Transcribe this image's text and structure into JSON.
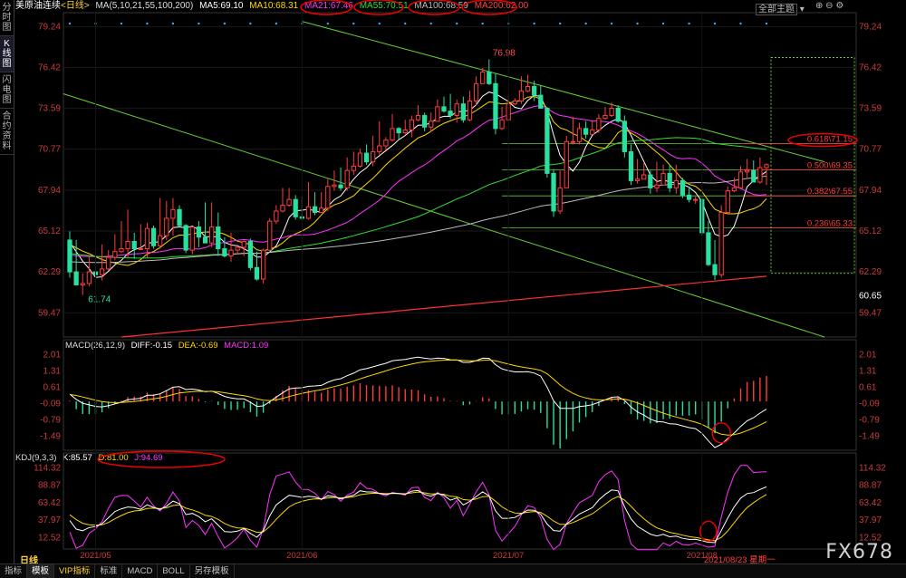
{
  "sidebar": {
    "tabs": [
      "分时图",
      "K线图",
      "闪电图",
      "合约资料"
    ]
  },
  "header": {
    "symbol": "美原油连续",
    "period": "<日线>",
    "ma_params": "MA(5,10,21,55,100,200)",
    "ma_values": [
      {
        "label": "MA5:69.10",
        "color": "#ffffff"
      },
      {
        "label": "MA10:68.31",
        "color": "#ffd700"
      },
      {
        "label": "MA21:67.46",
        "color": "#ff33ff"
      },
      {
        "label": "MA55:70.51",
        "color": "#33dd33"
      },
      {
        "label": "MA100:68.59",
        "color": "#bbbbbb"
      },
      {
        "label": "MA200:62.00",
        "color": "#ff4444"
      }
    ],
    "theme_button": "全部主题",
    "colors": {
      "up": "#ff3c3c",
      "down": "#29e0a0"
    }
  },
  "main_chart": {
    "y_ticks": [
      "79.24",
      "76.42",
      "73.59",
      "70.77",
      "67.94",
      "65.12",
      "62.29",
      "59.47"
    ],
    "extra_price": "60.65",
    "high_label": "76.98",
    "low_label": "61.74",
    "fib_levels": [
      {
        "label": "0.618\\71.15",
        "price": 71.15
      },
      {
        "label": "0.500\\69.35",
        "price": 69.35
      },
      {
        "label": "0.382\\67.55",
        "price": 67.55
      },
      {
        "label": "0.236\\65.33",
        "price": 65.33
      }
    ]
  },
  "macd": {
    "title": "MACD(26,12,9)",
    "diff": "DIFF:-0.15",
    "dea": "DEA:-0.69",
    "macd": "MACD:1.09",
    "y_ticks": [
      "2.01",
      "1.31",
      "0.61",
      "-0.09",
      "-0.79",
      "-1.49"
    ]
  },
  "kdj": {
    "title": "KDJ(9,3,3)",
    "k": "K:85.57",
    "d": "D:81.00",
    "j": "J:94.69",
    "y_ticks": [
      "114.32",
      "88.87",
      "63.42",
      "37.97",
      "12.52"
    ]
  },
  "x_axis": {
    "labels": [
      "2021/05",
      "2021/06",
      "2021/07",
      "2021/08"
    ],
    "current_date": "2021/08/23 星期一"
  },
  "bottom_tabs": {
    "period_label": "日线",
    "tabs": [
      "指标",
      "模板",
      "VIP指标",
      "标准",
      "MACD",
      "BOLL",
      "另存模板"
    ],
    "active": "模板"
  },
  "watermark": "FX678",
  "chart_data": {
    "type": "candlestick",
    "open": [
      64.5,
      62.3,
      61.4,
      61.5,
      62.3,
      62.1,
      62.5,
      63.3,
      63.7,
      63.9,
      64.4,
      63.9,
      63.9,
      65.3,
      64.1,
      64.8,
      66.0,
      66.6,
      65.5,
      63.8,
      65.4,
      64.7,
      64.3,
      65.4,
      63.9,
      63.4,
      63.8,
      64.0,
      64.4,
      62.6,
      61.8,
      63.8,
      65.8,
      66.5,
      66.9,
      67.3,
      66.1,
      66.0,
      66.8,
      66.4,
      66.7,
      68.2,
      68.3,
      68.1,
      69.3,
      69.6,
      70.5,
      69.9,
      70.6,
      71.0,
      71.4,
      72.2,
      71.9,
      72.1,
      72.8,
      73.1,
      72.3,
      72.7,
      73.7,
      73.4,
      73.1,
      73.9,
      72.8,
      74.1,
      75.3,
      76.1,
      75.3,
      72.2,
      72.8,
      73.9,
      74.1,
      74.8,
      75.1,
      74.5,
      73.6,
      69.1,
      66.5,
      68.1,
      71.3,
      71.3,
      72.2,
      71.8,
      72.1,
      72.9,
      73.1,
      73.6,
      72.7,
      70.6,
      68.6,
      68.7,
      69.0,
      68.1,
      68.3,
      69.1,
      68.1,
      68.6,
      67.6,
      67.3,
      67.3,
      65.0,
      62.8,
      62.1,
      66.4,
      67.9,
      68.1,
      69.2,
      69.3,
      68.5,
      69.5
    ],
    "high": [
      65.1,
      64.5,
      62.2,
      63.4,
      63.8,
      64.2,
      63.8,
      64.9,
      65.8,
      66.6,
      65.0,
      65.6,
      65.7,
      65.5,
      67.4,
      67.2,
      67.4,
      66.9,
      65.6,
      65.2,
      65.8,
      67.1,
      67.1,
      66.4,
      64.7,
      65.0,
      64.2,
      64.5,
      64.6,
      63.7,
      63.9,
      66.0,
      66.9,
      68.1,
      68.1,
      67.6,
      67.5,
      68.5,
      67.8,
      67.8,
      68.7,
      69.3,
      69.5,
      70.2,
      70.6,
      70.8,
      71.1,
      71.7,
      72.7,
      71.6,
      73.2,
      72.3,
      72.8,
      73.1,
      73.8,
      73.3,
      73.3,
      74.2,
      74.4,
      74.6,
      74.2,
      74.4,
      74.8,
      75.8,
      76.4,
      76.98,
      76.0,
      73.7,
      74.5,
      74.3,
      75.8,
      75.9,
      75.5,
      75.2,
      73.7,
      69.4,
      69.3,
      71.7,
      73.0,
      72.6,
      72.7,
      72.7,
      73.2,
      73.7,
      74.0,
      73.8,
      73.1,
      71.1,
      70.1,
      69.8,
      69.3,
      69.9,
      69.7,
      69.7,
      69.7,
      68.8,
      68.2,
      67.5,
      67.5,
      65.8,
      64.5,
      66.9,
      68.2,
      68.8,
      69.6,
      70.1,
      70.0,
      70.2,
      69.8
    ],
    "low": [
      61.9,
      61.4,
      60.7,
      61.3,
      61.9,
      61.7,
      62.4,
      63.1,
      63.6,
      63.3,
      63.2,
      63.8,
      63.3,
      63.9,
      63.9,
      64.5,
      64.8,
      65.4,
      63.6,
      63.5,
      64.0,
      64.3,
      64.0,
      63.4,
      63.3,
      63.0,
      63.5,
      63.4,
      62.4,
      61.7,
      61.5,
      63.8,
      65.6,
      66.4,
      66.8,
      65.9,
      65.9,
      65.9,
      66.2,
      66.4,
      66.5,
      67.9,
      67.9,
      67.9,
      69.0,
      69.5,
      69.7,
      69.6,
      70.4,
      70.7,
      71.3,
      71.4,
      71.8,
      71.6,
      72.7,
      72.0,
      72.0,
      72.7,
      73.3,
      72.9,
      72.6,
      72.6,
      72.7,
      73.8,
      75.3,
      75.2,
      71.8,
      72.1,
      72.7,
      73.8,
      73.9,
      74.7,
      74.1,
      73.6,
      68.8,
      66.1,
      66.3,
      68.1,
      71.1,
      71.1,
      71.5,
      71.8,
      71.9,
      72.8,
      73.0,
      72.6,
      70.2,
      68.3,
      68.4,
      68.7,
      67.7,
      67.8,
      68.3,
      67.8,
      67.7,
      67.4,
      67.1,
      67.0,
      64.8,
      62.7,
      61.74,
      61.9,
      66.3,
      67.8,
      68.1,
      68.8,
      68.5,
      68.4,
      68.3
    ],
    "close": [
      62.3,
      61.4,
      61.5,
      62.3,
      62.1,
      62.5,
      63.3,
      63.7,
      63.9,
      64.4,
      63.9,
      63.9,
      65.3,
      64.1,
      64.8,
      66.0,
      66.6,
      65.5,
      63.8,
      65.4,
      64.7,
      64.3,
      65.4,
      63.9,
      63.4,
      63.8,
      64.0,
      64.4,
      62.6,
      61.8,
      63.8,
      65.8,
      66.5,
      66.9,
      67.3,
      66.1,
      66.0,
      66.8,
      66.4,
      66.7,
      68.2,
      68.3,
      68.1,
      69.3,
      69.6,
      70.5,
      69.9,
      70.6,
      71.0,
      71.4,
      72.2,
      71.9,
      72.1,
      72.8,
      73.1,
      72.3,
      72.7,
      73.7,
      73.4,
      73.1,
      73.9,
      72.8,
      74.1,
      75.3,
      76.1,
      75.3,
      72.2,
      72.8,
      73.9,
      74.1,
      74.8,
      75.1,
      74.5,
      73.6,
      69.1,
      66.5,
      68.1,
      71.3,
      71.3,
      72.2,
      71.8,
      72.1,
      72.9,
      73.1,
      73.6,
      72.7,
      70.6,
      68.6,
      68.7,
      69.0,
      68.1,
      68.3,
      69.1,
      68.1,
      68.6,
      67.6,
      67.3,
      67.3,
      65.0,
      62.8,
      62.1,
      66.4,
      67.9,
      68.1,
      69.2,
      69.3,
      68.5,
      69.5,
      69.7
    ],
    "y_range": [
      57.8,
      80.2
    ]
  }
}
